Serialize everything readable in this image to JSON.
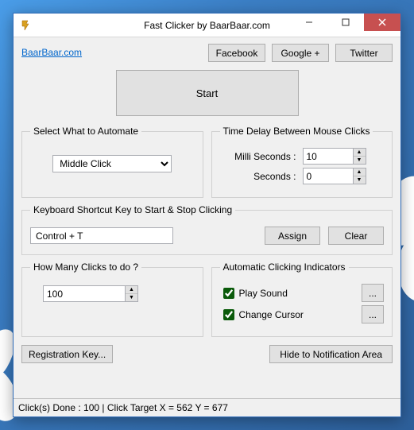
{
  "window": {
    "title": "Fast Clicker by BaarBaar.com"
  },
  "header": {
    "link": "BaarBaar.com",
    "social": {
      "facebook": "Facebook",
      "google": "Google +",
      "twitter": "Twitter"
    }
  },
  "start_label": "Start",
  "automate": {
    "legend": "Select What to Automate",
    "selected": "Middle Click"
  },
  "delay": {
    "legend": "Time Delay Between Mouse Clicks",
    "ms_label": "Milli Seconds :",
    "ms_value": "10",
    "sec_label": "Seconds :",
    "sec_value": "0"
  },
  "shortcut": {
    "legend": "Keyboard Shortcut Key to Start & Stop Clicking",
    "value": "Control + T",
    "assign": "Assign",
    "clear": "Clear"
  },
  "howmany": {
    "legend": "How Many Clicks to do ?",
    "value": "100"
  },
  "indicators": {
    "legend": "Automatic Clicking Indicators",
    "play_sound": "Play Sound",
    "change_cursor": "Change Cursor",
    "ellipsis": "..."
  },
  "bottom": {
    "registration": "Registration Key...",
    "hide": "Hide to Notification Area"
  },
  "status": "Click(s) Done : 100   |   Click Target X = 562 Y = 677"
}
